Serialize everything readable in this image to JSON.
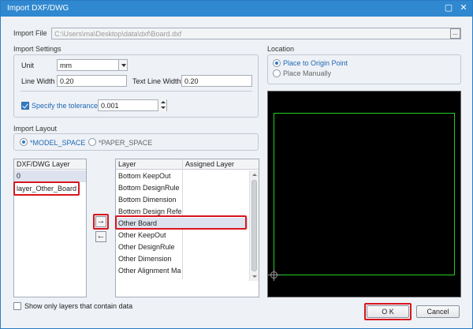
{
  "window": {
    "title": "Import DXF/DWG"
  },
  "import_file": {
    "label": "Import File",
    "value": "C:\\Users\\ma\\Desktop\\data\\dxf\\Board.dxf",
    "browse_label": "..."
  },
  "import_settings": {
    "label": "Import Settings",
    "unit_label": "Unit",
    "unit_value": "mm",
    "line_width_label": "Line Width",
    "line_width_value": "0.20",
    "text_line_width_label": "Text Line Width",
    "text_line_width_value": "0.20",
    "tolerance_label": "Specify the tolerance",
    "tolerance_value": "0.001",
    "tolerance_checked": true
  },
  "location": {
    "label": "Location",
    "options": [
      {
        "label": "Place to Origin Point",
        "selected": true
      },
      {
        "label": "Place Manually",
        "selected": false
      }
    ]
  },
  "import_layout": {
    "label": "Import Layout",
    "options": [
      {
        "label": "*MODEL_SPACE",
        "selected": true
      },
      {
        "label": "*PAPER_SPACE",
        "selected": false
      }
    ]
  },
  "dxf_layers": {
    "header": "DXF/DWG Layer",
    "items": [
      "0",
      "layer_Other_Board"
    ]
  },
  "layers_table": {
    "headers": [
      "Layer",
      "Assigned Layer"
    ],
    "rows": [
      {
        "layer": "Bottom KeepOut",
        "assigned": ""
      },
      {
        "layer": "Bottom DesignRule",
        "assigned": ""
      },
      {
        "layer": "Bottom Dimension",
        "assigned": ""
      },
      {
        "layer": "Bottom Design Refe",
        "assigned": ""
      },
      {
        "layer": "Other Board",
        "assigned": ""
      },
      {
        "layer": "Other KeepOut",
        "assigned": ""
      },
      {
        "layer": "Other DesignRule",
        "assigned": ""
      },
      {
        "layer": "Other Dimension",
        "assigned": ""
      },
      {
        "layer": "Other Alignment Ma",
        "assigned": ""
      }
    ]
  },
  "move_buttons": {
    "right": "→",
    "left": "←"
  },
  "show_only": {
    "label": "Show only layers that contain data",
    "checked": false
  },
  "buttons": {
    "ok": "O K",
    "cancel": "Cancel"
  },
  "colors": {
    "title_bar": "#2f88d0",
    "highlight": "#d8151d",
    "preview_bg": "#000000",
    "board_outline": "#20d020"
  }
}
